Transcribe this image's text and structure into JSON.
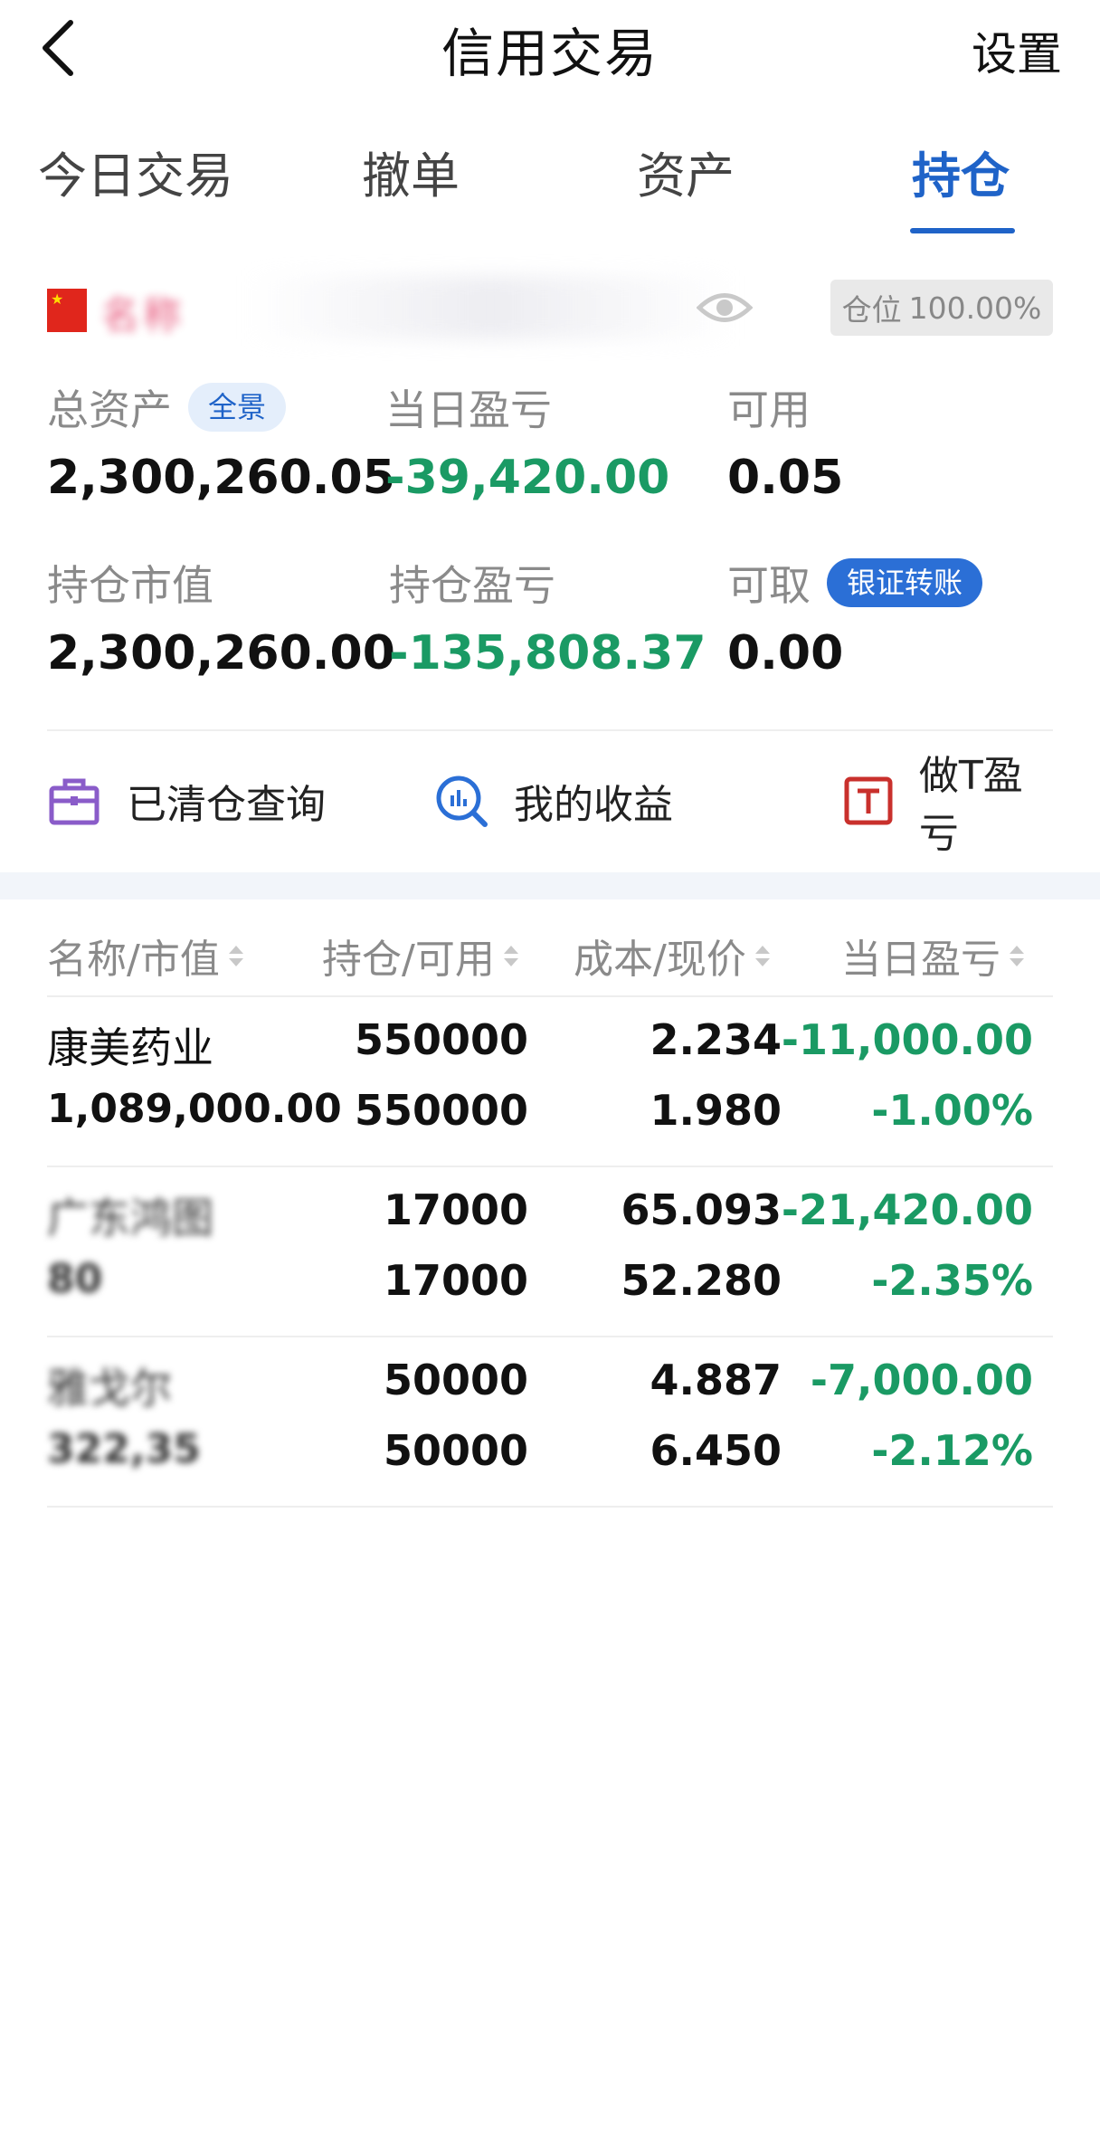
{
  "header": {
    "title": "信用交易",
    "settings": "设置"
  },
  "tabs": [
    {
      "label": "今日交易",
      "active": false
    },
    {
      "label": "撤单",
      "active": false
    },
    {
      "label": "资产",
      "active": false
    },
    {
      "label": "持仓",
      "active": true
    }
  ],
  "account": {
    "name_blurred": "名称",
    "position_label": "仓位",
    "position_value": "100.00%"
  },
  "summary": {
    "total_assets": {
      "label": "总资产",
      "badge": "全景",
      "value": "2,300,260.05"
    },
    "daily_pnl": {
      "label": "当日盈亏",
      "value": "-39,420.00"
    },
    "available": {
      "label": "可用",
      "value": "0.05"
    },
    "market_value": {
      "label": "持仓市值",
      "value": "2,300,260.00"
    },
    "position_pnl": {
      "label": "持仓盈亏",
      "value": "-135,808.37"
    },
    "withdrawable": {
      "label": "可取",
      "badge": "银证转账",
      "value": "0.00"
    }
  },
  "quick_actions": [
    {
      "label": "已清仓查询",
      "icon": "briefcase-icon"
    },
    {
      "label": "我的收益",
      "icon": "chart-search-icon"
    },
    {
      "label": "做T盈亏",
      "icon": "t-box-icon"
    }
  ],
  "table": {
    "headers": [
      "名称/市值",
      "持仓/可用",
      "成本/现价",
      "当日盈亏"
    ],
    "rows": [
      {
        "name": "康美药业",
        "market_value": "1,089,000.00",
        "holding": "550000",
        "available": "550000",
        "cost": "2.234",
        "price": "1.980",
        "pnl": "-11,000.00",
        "pnl_pct": "-1.00%",
        "blurred": false
      },
      {
        "name": "广东鸿图",
        "market_value": "80",
        "holding": "17000",
        "available": "17000",
        "cost": "65.093",
        "price": "52.280",
        "pnl": "-21,420.00",
        "pnl_pct": "-2.35%",
        "blurred": true
      },
      {
        "name": "雅戈尔",
        "market_value": "322,35",
        "holding": "50000",
        "available": "50000",
        "cost": "4.887",
        "price": "6.450",
        "pnl": "-7,000.00",
        "pnl_pct": "-2.12%",
        "blurred": true
      }
    ]
  },
  "colors": {
    "accent": "#1f63c8",
    "loss_green": "#1a9a64",
    "label_gray": "#8a8a8a"
  }
}
